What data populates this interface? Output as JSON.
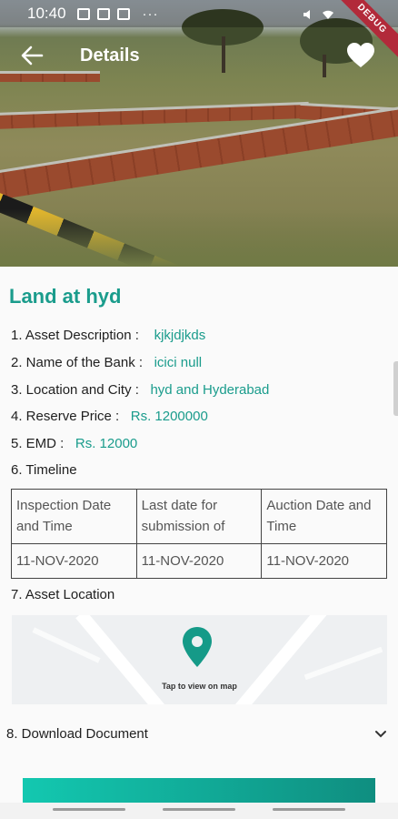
{
  "status_bar": {
    "time": "10:40",
    "dots": "···",
    "debug_banner": "DEBUG"
  },
  "app_bar": {
    "back_icon": "arrow-left-icon",
    "title": "Details",
    "favorite_icon": "heart-icon"
  },
  "property": {
    "title": "Land at hyd",
    "fields": [
      {
        "label": "1.  Asset Description   :",
        "value": "kjkjdjkds"
      },
      {
        "label": "2. Name of the Bank  :",
        "value": "icici null"
      },
      {
        "label": "3. Location and City  :",
        "value": "hyd and Hyderabad"
      },
      {
        "label": "4. Reserve Price  :",
        "value": "Rs. 1200000"
      },
      {
        "label": "5. EMD :",
        "value": "Rs. 12000"
      }
    ],
    "timeline_label": "6. Timeline",
    "timeline": {
      "headers": [
        "Inspection Date and Time",
        "Last date for submission of",
        "Auction Date and Time"
      ],
      "values": [
        "11-NOV-2020",
        "11-NOV-2020",
        "11-NOV-2020"
      ]
    },
    "location_label": "7. Asset Location",
    "map": {
      "pin_icon": "location-pin-icon",
      "tap_label": "Tap to view on map"
    },
    "download_label": "8. Download Document",
    "download_icon": "chevron-down-icon"
  },
  "colors": {
    "accent": "#1a9c8c",
    "button_start": "#13c8b0",
    "button_end": "#0f8e80"
  }
}
